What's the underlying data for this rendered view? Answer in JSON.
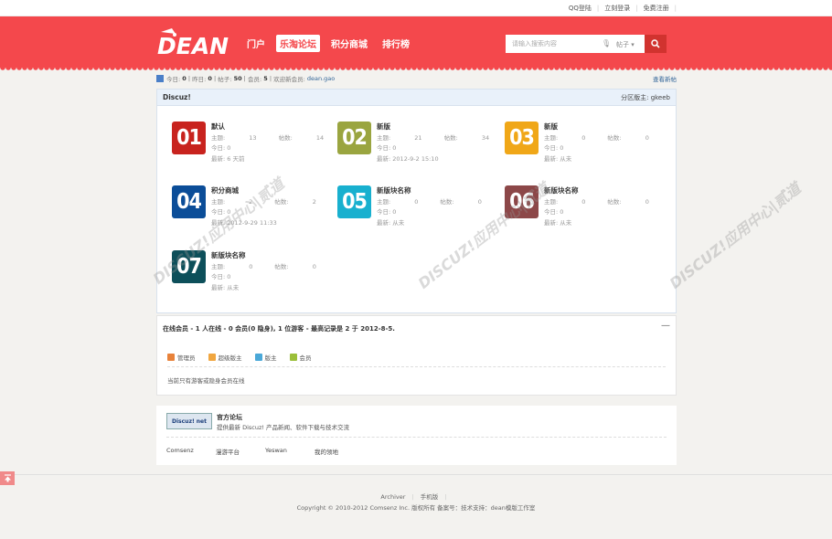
{
  "topbar": {
    "links": [
      "QQ登陆",
      "立刻登录",
      "免费注册"
    ]
  },
  "header": {
    "logo_text": "DEAN",
    "nav": [
      {
        "label": "门户",
        "active": false
      },
      {
        "label": "乐淘论坛",
        "active": true
      },
      {
        "label": "积分商城",
        "active": false
      },
      {
        "label": "排行榜",
        "active": false
      }
    ],
    "search": {
      "placeholder": "请输入搜索内容",
      "type": "帖子"
    }
  },
  "stats": {
    "today_label": "今日:",
    "today": "0",
    "yesterday_label": "昨日:",
    "yesterday": "0",
    "posts_label": "帖子:",
    "posts": "50",
    "members_label": "会员:",
    "members": "5",
    "welcome_label": "欢迎新会员:",
    "new_member": "dean.gao",
    "new_posts_link": "查看新帖"
  },
  "category": {
    "name": "Discuz!",
    "moderator_label": "分区版主:",
    "moderator": "gkeeb",
    "boards": [
      {
        "num": "01",
        "color": "#c8231e",
        "name": "默认",
        "topics": "13",
        "posts": "14",
        "today": "0",
        "latest": "6 天前"
      },
      {
        "num": "02",
        "color": "#9aa540",
        "name": "新版",
        "topics": "21",
        "posts": "34",
        "today": "0",
        "latest": "2012-9-2 15:10"
      },
      {
        "num": "03",
        "color": "#f0a718",
        "name": "新版",
        "topics": "0",
        "posts": "0",
        "today": "0",
        "latest": "从未"
      },
      {
        "num": "04",
        "color": "#0b4d98",
        "name": "积分商城",
        "topics": "2",
        "posts": "2",
        "today": "0",
        "latest": "2012-9-29 11:33"
      },
      {
        "num": "05",
        "color": "#18b0cf",
        "name": "新版块名称",
        "topics": "0",
        "posts": "0",
        "today": "0",
        "latest": "从未"
      },
      {
        "num": "06",
        "color": "#8c4748",
        "name": "新版块名称",
        "topics": "0",
        "posts": "0",
        "today": "0",
        "latest": "从未"
      },
      {
        "num": "07",
        "color": "#0d4f5a",
        "name": "新版块名称",
        "topics": "0",
        "posts": "0",
        "today": "0",
        "latest": "从未"
      }
    ],
    "labels": {
      "topics": "主题:",
      "posts": "帖数:",
      "today": "今日:",
      "latest": "最新:"
    }
  },
  "online": {
    "summary": "在线会员 - 1 人在线 - 0 会员(0 隐身), 1 位游客 - 最高记录是 2 于 2012-8-5.",
    "collapse": "—",
    "legend": [
      {
        "label": "管理员",
        "color": "#e8823a"
      },
      {
        "label": "超级版主",
        "color": "#f0a640"
      },
      {
        "label": "版主",
        "color": "#4aa8d8"
      },
      {
        "label": "会员",
        "color": "#9bbf3a"
      }
    ],
    "empty_text": "当前只有游客或隐身会员在线"
  },
  "friendlinks": {
    "logo_text": "Discuz! net",
    "title": "官方论坛",
    "desc": "提供最新 Discuz! 产品新闻、软件下载与技术交流",
    "links": [
      "Comsenz",
      "漫游平台",
      "Yeswan",
      "我的领地"
    ]
  },
  "footer": {
    "links": [
      "Archiver",
      "手机版"
    ],
    "copyright": "Copyright © 2010-2012 Comsenz Inc. 版权所有 备案号：技术支持：dean模版工作室"
  },
  "watermark": "DISCUZ!应用中心|贰道 addon.dismall.com"
}
